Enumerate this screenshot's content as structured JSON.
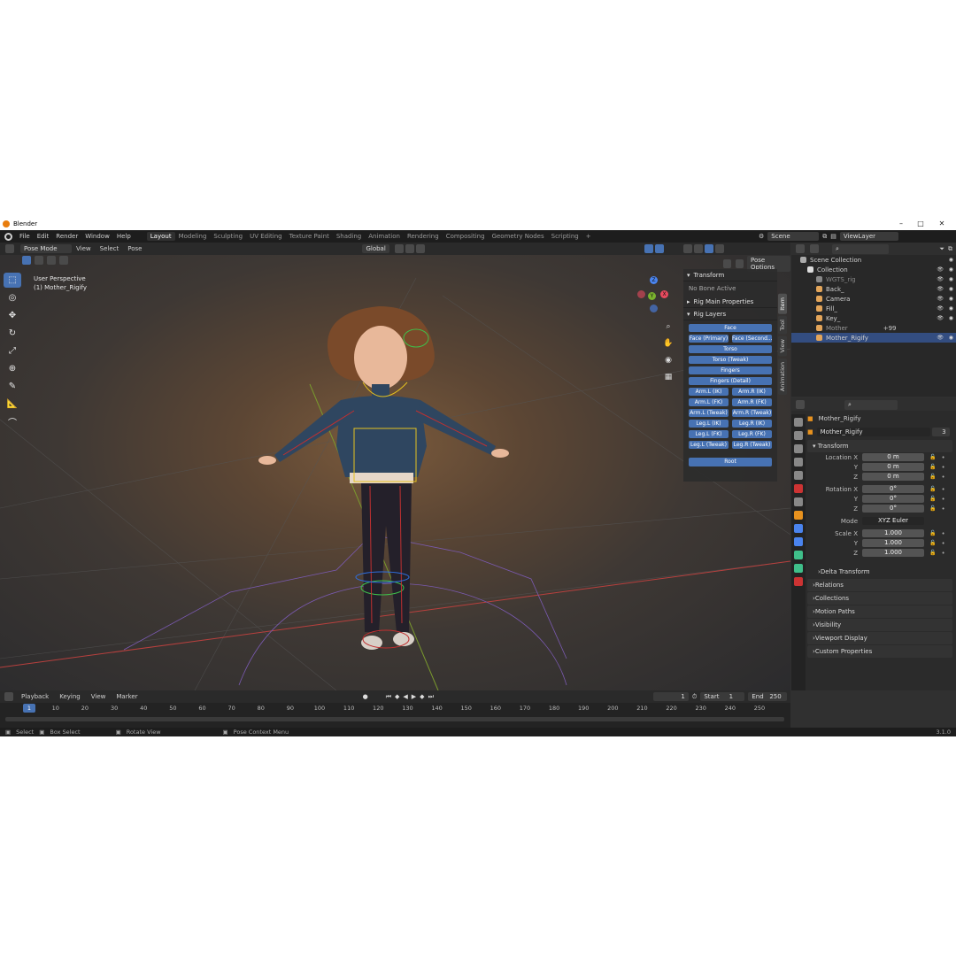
{
  "window": {
    "title": "Blender"
  },
  "menu": [
    "File",
    "Edit",
    "Render",
    "Window",
    "Help"
  ],
  "workspaces": [
    "Layout",
    "Modeling",
    "Sculpting",
    "UV Editing",
    "Texture Paint",
    "Shading",
    "Animation",
    "Rendering",
    "Compositing",
    "Geometry Nodes",
    "Scripting"
  ],
  "scene": {
    "scene_name": "Scene",
    "view_layer": "ViewLayer"
  },
  "viewport": {
    "mode": "Pose Mode",
    "menus": [
      "View",
      "Select",
      "Pose"
    ],
    "transform_orientation": "Global",
    "pose_options": "Pose Options",
    "info_line1": "User Perspective",
    "info_line2": "(1) Mother_Rigify"
  },
  "npanel": {
    "transform_header": "Transform",
    "no_bone": "No Bone Active",
    "rig_main": "Rig Main Properties",
    "rig_layers": "Rig Layers",
    "rows": [
      [
        "Face"
      ],
      [
        "Face (Primary)",
        "Face (Second..."
      ],
      [
        "Torso"
      ],
      [
        "Torso (Tweak)"
      ],
      [
        "Fingers"
      ],
      [
        "Fingers (Detail)"
      ],
      [
        "Arm.L (IK)",
        "Arm.R (IK)"
      ],
      [
        "Arm.L (FK)",
        "Arm.R (FK)"
      ],
      [
        "Arm.L (Tweak)",
        "Arm.R (Tweak)"
      ],
      [
        "Leg.L (IK)",
        "Leg.R (IK)"
      ],
      [
        "Leg.L (FK)",
        "Leg.R (FK)"
      ],
      [
        "Leg.L (Tweak)",
        "Leg.R (Tweak)"
      ]
    ],
    "root": "Root",
    "tabs": [
      "Item",
      "Tool",
      "View",
      "Animation"
    ]
  },
  "outliner": {
    "root": "Scene Collection",
    "collection": "Collection",
    "items": [
      "WGTS_rig",
      "Back_",
      "Camera",
      "Fill_",
      "Key_",
      "Mother",
      "Mother_Rigify"
    ],
    "mother_badge": "+99"
  },
  "properties": {
    "object_name": "Mother_Rigify",
    "data_name": "Mother_Rigify",
    "users": "3",
    "transform": "Transform",
    "location": [
      {
        "label": "Location X",
        "val": "0 m"
      },
      {
        "label": "Y",
        "val": "0 m"
      },
      {
        "label": "Z",
        "val": "0 m"
      }
    ],
    "rotation": [
      {
        "label": "Rotation X",
        "val": "0°"
      },
      {
        "label": "Y",
        "val": "0°"
      },
      {
        "label": "Z",
        "val": "0°"
      }
    ],
    "mode_label": "Mode",
    "mode_val": "XYZ Euler",
    "scale": [
      {
        "label": "Scale X",
        "val": "1.000"
      },
      {
        "label": "Y",
        "val": "1.000"
      },
      {
        "label": "Z",
        "val": "1.000"
      }
    ],
    "sections": [
      "Delta Transform",
      "Relations",
      "Collections",
      "Motion Paths",
      "Visibility",
      "Viewport Display",
      "Custom Properties"
    ]
  },
  "timeline": {
    "menus": [
      "Playback",
      "Keying",
      "View",
      "Marker"
    ],
    "current_frame": "1",
    "start_label": "Start",
    "start": "1",
    "end_label": "End",
    "end": "250",
    "ticks": [
      "1",
      "10",
      "20",
      "30",
      "40",
      "50",
      "60",
      "70",
      "80",
      "90",
      "100",
      "110",
      "120",
      "130",
      "140",
      "150",
      "160",
      "170",
      "180",
      "190",
      "200",
      "210",
      "220",
      "230",
      "240",
      "250"
    ]
  },
  "status": {
    "select": "Select",
    "box": "Box Select",
    "rotate": "Rotate View",
    "context": "Pose Context Menu",
    "version": "3.1.0"
  },
  "colors": {
    "accent": "#4772b3",
    "header": "#1d1d1d",
    "panel": "#2b2b2b"
  }
}
